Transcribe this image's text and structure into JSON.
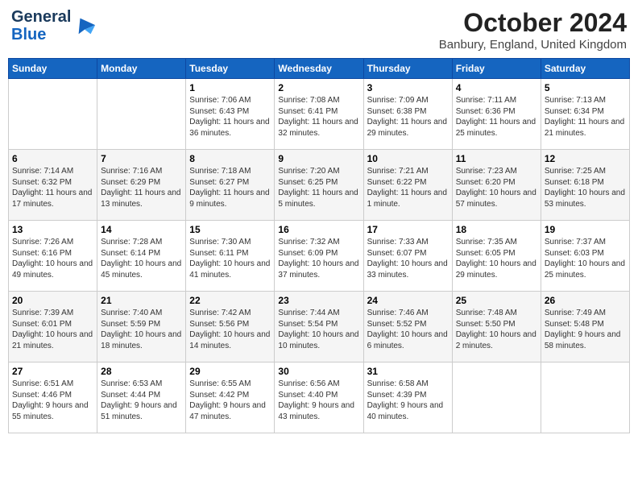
{
  "header": {
    "logo_general": "General",
    "logo_blue": "Blue",
    "month": "October 2024",
    "location": "Banbury, England, United Kingdom"
  },
  "days_of_week": [
    "Sunday",
    "Monday",
    "Tuesday",
    "Wednesday",
    "Thursday",
    "Friday",
    "Saturday"
  ],
  "weeks": [
    [
      {
        "day": "",
        "info": ""
      },
      {
        "day": "",
        "info": ""
      },
      {
        "day": "1",
        "info": "Sunrise: 7:06 AM\nSunset: 6:43 PM\nDaylight: 11 hours and 36 minutes."
      },
      {
        "day": "2",
        "info": "Sunrise: 7:08 AM\nSunset: 6:41 PM\nDaylight: 11 hours and 32 minutes."
      },
      {
        "day": "3",
        "info": "Sunrise: 7:09 AM\nSunset: 6:38 PM\nDaylight: 11 hours and 29 minutes."
      },
      {
        "day": "4",
        "info": "Sunrise: 7:11 AM\nSunset: 6:36 PM\nDaylight: 11 hours and 25 minutes."
      },
      {
        "day": "5",
        "info": "Sunrise: 7:13 AM\nSunset: 6:34 PM\nDaylight: 11 hours and 21 minutes."
      }
    ],
    [
      {
        "day": "6",
        "info": "Sunrise: 7:14 AM\nSunset: 6:32 PM\nDaylight: 11 hours and 17 minutes."
      },
      {
        "day": "7",
        "info": "Sunrise: 7:16 AM\nSunset: 6:29 PM\nDaylight: 11 hours and 13 minutes."
      },
      {
        "day": "8",
        "info": "Sunrise: 7:18 AM\nSunset: 6:27 PM\nDaylight: 11 hours and 9 minutes."
      },
      {
        "day": "9",
        "info": "Sunrise: 7:20 AM\nSunset: 6:25 PM\nDaylight: 11 hours and 5 minutes."
      },
      {
        "day": "10",
        "info": "Sunrise: 7:21 AM\nSunset: 6:22 PM\nDaylight: 11 hours and 1 minute."
      },
      {
        "day": "11",
        "info": "Sunrise: 7:23 AM\nSunset: 6:20 PM\nDaylight: 10 hours and 57 minutes."
      },
      {
        "day": "12",
        "info": "Sunrise: 7:25 AM\nSunset: 6:18 PM\nDaylight: 10 hours and 53 minutes."
      }
    ],
    [
      {
        "day": "13",
        "info": "Sunrise: 7:26 AM\nSunset: 6:16 PM\nDaylight: 10 hours and 49 minutes."
      },
      {
        "day": "14",
        "info": "Sunrise: 7:28 AM\nSunset: 6:14 PM\nDaylight: 10 hours and 45 minutes."
      },
      {
        "day": "15",
        "info": "Sunrise: 7:30 AM\nSunset: 6:11 PM\nDaylight: 10 hours and 41 minutes."
      },
      {
        "day": "16",
        "info": "Sunrise: 7:32 AM\nSunset: 6:09 PM\nDaylight: 10 hours and 37 minutes."
      },
      {
        "day": "17",
        "info": "Sunrise: 7:33 AM\nSunset: 6:07 PM\nDaylight: 10 hours and 33 minutes."
      },
      {
        "day": "18",
        "info": "Sunrise: 7:35 AM\nSunset: 6:05 PM\nDaylight: 10 hours and 29 minutes."
      },
      {
        "day": "19",
        "info": "Sunrise: 7:37 AM\nSunset: 6:03 PM\nDaylight: 10 hours and 25 minutes."
      }
    ],
    [
      {
        "day": "20",
        "info": "Sunrise: 7:39 AM\nSunset: 6:01 PM\nDaylight: 10 hours and 21 minutes."
      },
      {
        "day": "21",
        "info": "Sunrise: 7:40 AM\nSunset: 5:59 PM\nDaylight: 10 hours and 18 minutes."
      },
      {
        "day": "22",
        "info": "Sunrise: 7:42 AM\nSunset: 5:56 PM\nDaylight: 10 hours and 14 minutes."
      },
      {
        "day": "23",
        "info": "Sunrise: 7:44 AM\nSunset: 5:54 PM\nDaylight: 10 hours and 10 minutes."
      },
      {
        "day": "24",
        "info": "Sunrise: 7:46 AM\nSunset: 5:52 PM\nDaylight: 10 hours and 6 minutes."
      },
      {
        "day": "25",
        "info": "Sunrise: 7:48 AM\nSunset: 5:50 PM\nDaylight: 10 hours and 2 minutes."
      },
      {
        "day": "26",
        "info": "Sunrise: 7:49 AM\nSunset: 5:48 PM\nDaylight: 9 hours and 58 minutes."
      }
    ],
    [
      {
        "day": "27",
        "info": "Sunrise: 6:51 AM\nSunset: 4:46 PM\nDaylight: 9 hours and 55 minutes."
      },
      {
        "day": "28",
        "info": "Sunrise: 6:53 AM\nSunset: 4:44 PM\nDaylight: 9 hours and 51 minutes."
      },
      {
        "day": "29",
        "info": "Sunrise: 6:55 AM\nSunset: 4:42 PM\nDaylight: 9 hours and 47 minutes."
      },
      {
        "day": "30",
        "info": "Sunrise: 6:56 AM\nSunset: 4:40 PM\nDaylight: 9 hours and 43 minutes."
      },
      {
        "day": "31",
        "info": "Sunrise: 6:58 AM\nSunset: 4:39 PM\nDaylight: 9 hours and 40 minutes."
      },
      {
        "day": "",
        "info": ""
      },
      {
        "day": "",
        "info": ""
      }
    ]
  ]
}
